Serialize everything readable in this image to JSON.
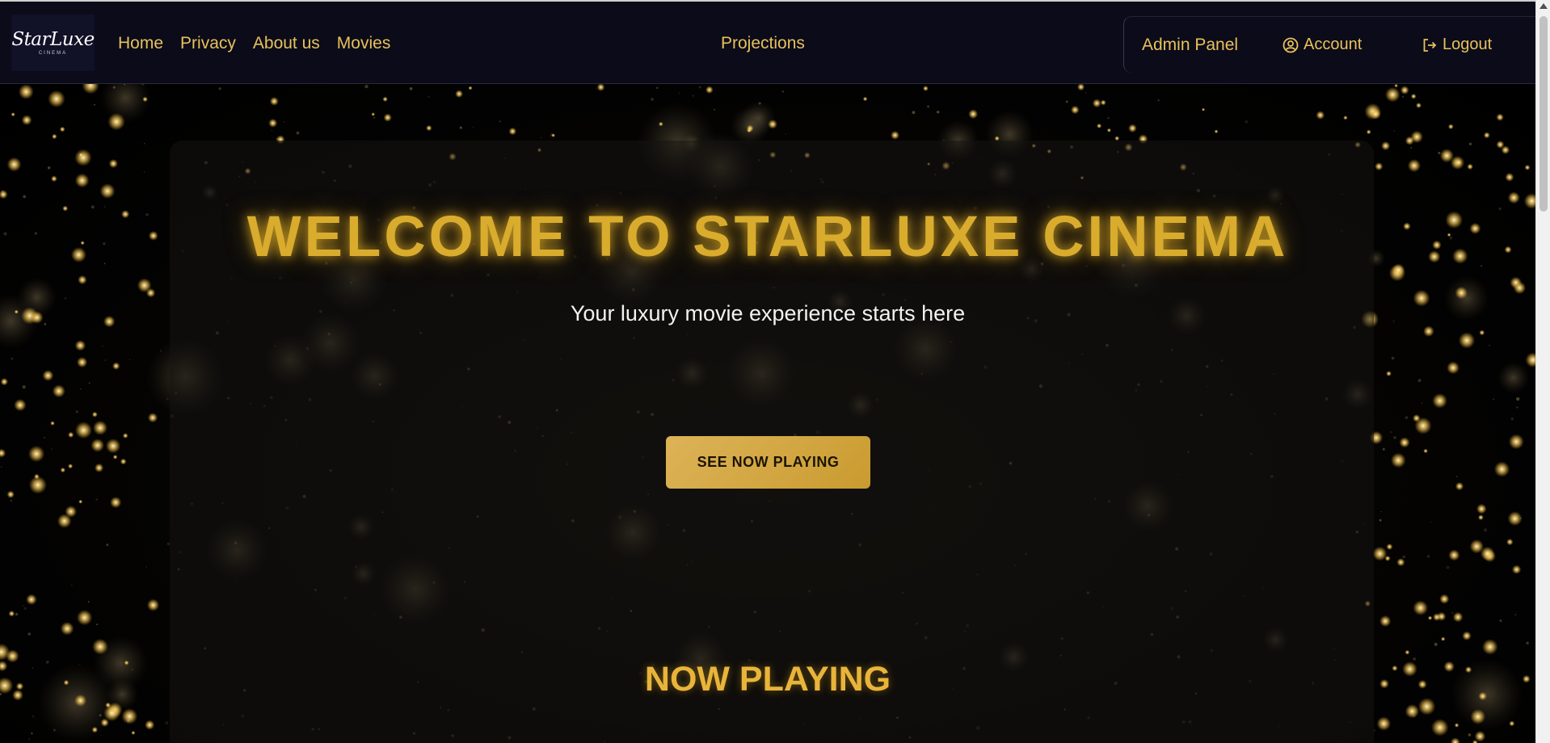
{
  "brand": {
    "logo_text": "StarLuxe",
    "logo_subtext": "CINEMA"
  },
  "nav": {
    "left_links": [
      "Home",
      "Privacy",
      "About us",
      "Movies"
    ],
    "center_link": "Projections",
    "admin_label": "Admin Panel",
    "account_label": "Account",
    "logout_label": "Logout",
    "account_icon": "user-circle-icon",
    "logout_icon": "logout-icon"
  },
  "hero": {
    "title": "WELCOME TO STARLUXE CINEMA",
    "subtitle": "Your luxury movie experience starts here",
    "cta_label": "SEE NOW PLAYING"
  },
  "sections": {
    "now_playing_title": "NOW PLAYING"
  },
  "colors": {
    "accent_gold": "#d9ac2e",
    "nav_background": "#0b0b1a",
    "page_background": "#000000"
  }
}
